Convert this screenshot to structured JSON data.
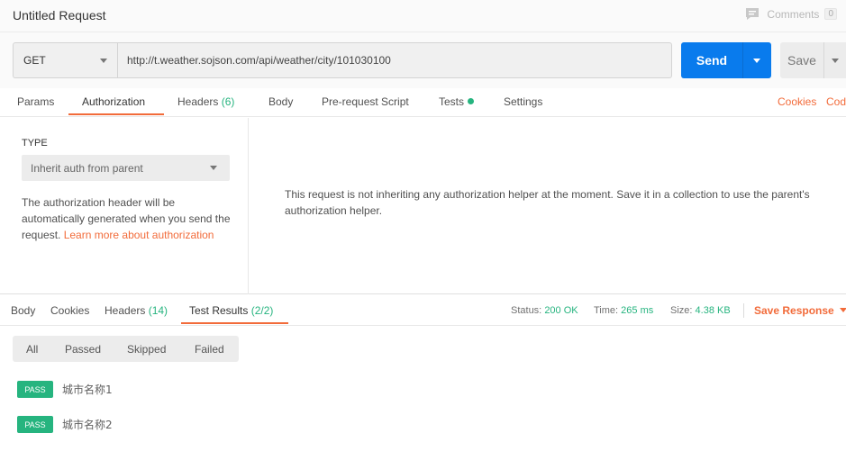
{
  "title": "Untitled Request",
  "comments": {
    "label": "Comments",
    "count": "0",
    "icon": "comment-icon"
  },
  "request": {
    "method": "GET",
    "url": "http://t.weather.sojson.com/api/weather/city/101030100",
    "send_label": "Send",
    "save_label": "Save"
  },
  "request_tabs": {
    "params": "Params",
    "authorization": "Authorization",
    "headers": "Headers",
    "headers_count": "(6)",
    "body": "Body",
    "prerequest": "Pre-request Script",
    "tests": "Tests",
    "settings": "Settings",
    "active": "Authorization",
    "cookies_link": "Cookies",
    "code_link": "Code"
  },
  "auth": {
    "type_label": "TYPE",
    "type_value": "Inherit auth from parent",
    "description": "The authorization header will be automatically generated when you send the request.",
    "learn_more": "Learn more about authorization",
    "message": "This request is not inheriting any authorization helper at the moment. Save it in a collection to use the parent's authorization helper."
  },
  "response_tabs": {
    "body": "Body",
    "cookies": "Cookies",
    "headers": "Headers",
    "headers_count": "(14)",
    "test_results": "Test Results",
    "test_results_count": "(2/2)",
    "active": "Test Results"
  },
  "status": {
    "status_label": "Status:",
    "status_value": "200 OK",
    "time_label": "Time:",
    "time_value": "265 ms",
    "size_label": "Size:",
    "size_value": "4.38 KB",
    "save_response": "Save Response"
  },
  "filters": [
    "All",
    "Passed",
    "Skipped",
    "Failed"
  ],
  "results": [
    {
      "badge": "PASS",
      "name": "城市名称1"
    },
    {
      "badge": "PASS",
      "name": "城市名称2"
    }
  ],
  "colors": {
    "accent": "#f26b3a",
    "send": "#097bed",
    "pass": "#26b47f"
  }
}
